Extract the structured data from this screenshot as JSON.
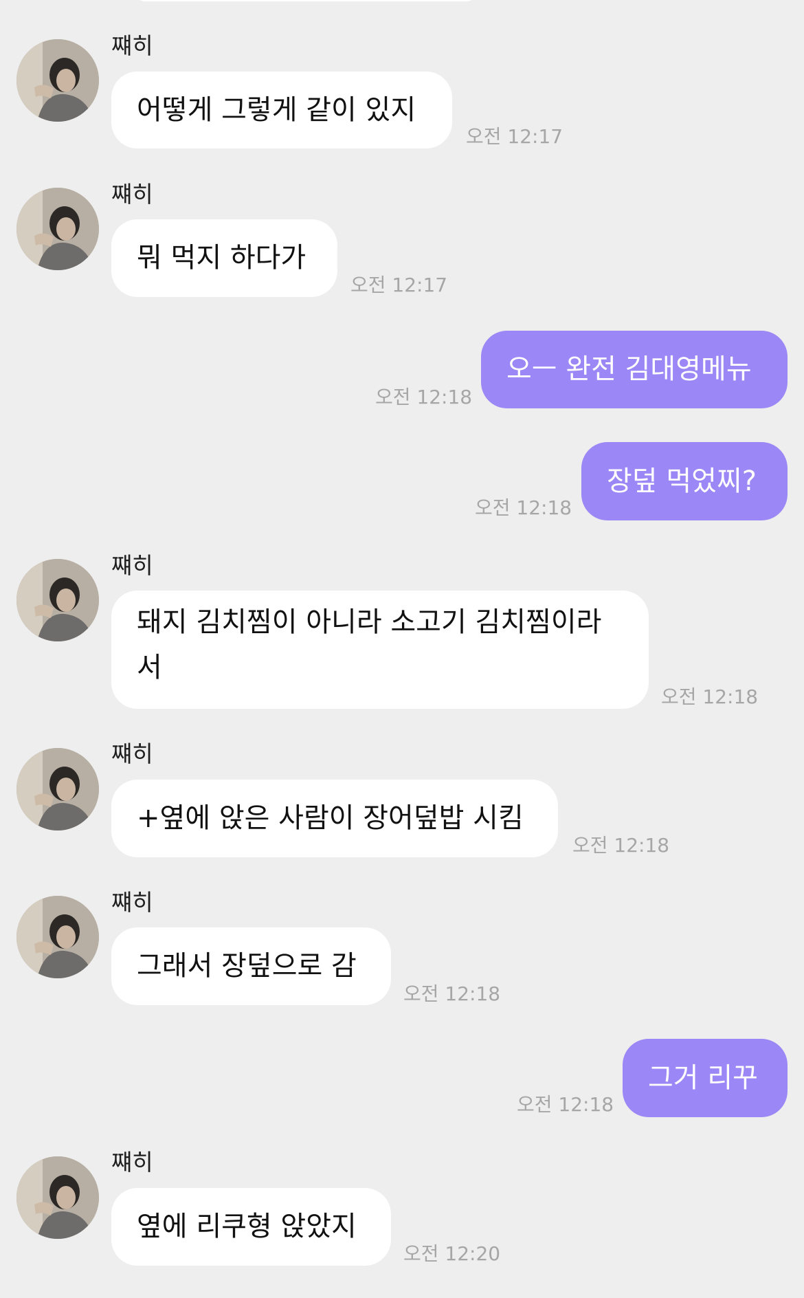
{
  "chat": {
    "messages": [
      {
        "sender": "쨰히",
        "text": "어떻게 그렇게 같이 있지",
        "time": "오전 12:17"
      },
      {
        "sender": "쨰히",
        "text": "뭐 먹지 하다가",
        "time": "오전 12:17"
      },
      {
        "text": "오ㅡ 완전 김대영메뉴",
        "time": "오전 12:18"
      },
      {
        "text": "장덮 먹었찌?",
        "time": "오전 12:18"
      },
      {
        "sender": "쨰히",
        "text_line1": "돼지 김치찜이 아니라 소고기 김치찜이라",
        "text_line2": "서",
        "time": "오전 12:18"
      },
      {
        "sender": "쨰히",
        "text": "+옆에 앉은 사람이 장어덮밥 시킴",
        "time": "오전 12:18"
      },
      {
        "sender": "쨰히",
        "text": "그래서 장덮으로 감",
        "time": "오전 12:18"
      },
      {
        "text": "그거 리꾸",
        "time": "오전 12:18"
      },
      {
        "sender": "쨰히",
        "text": "옆에 리쿠형 앉았지",
        "time": "오전 12:20"
      }
    ]
  },
  "colors": {
    "background": "#eeeeee",
    "incoming_bubble": "#ffffff",
    "outgoing_bubble": "#9b87f5",
    "timestamp": "#a6a6a6"
  },
  "icons": {
    "avatar": "profile-photo"
  }
}
